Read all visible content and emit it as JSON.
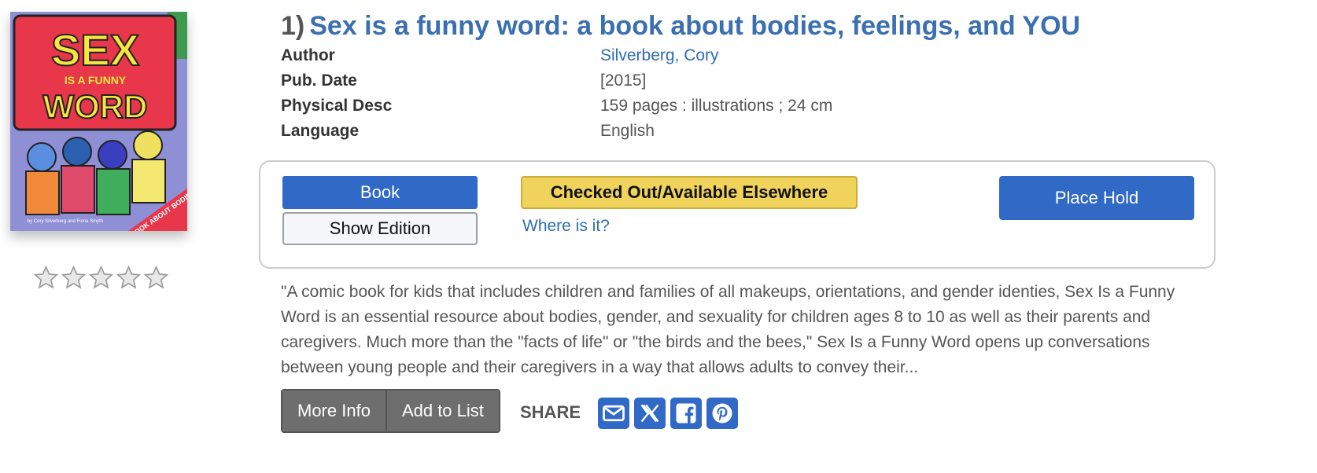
{
  "result": {
    "number": "1)",
    "title": "Sex is a funny word: a book about bodies, feelings, and YOU"
  },
  "cover": {
    "title_line1": "SEX",
    "title_line2": "IS A FUNNY",
    "title_line3": "WORD",
    "tagline": "A BOOK ABOUT BODIES, FEELINGS, AND YOU",
    "credit": "by Cory Silverberg and Fiona Smyth"
  },
  "rating": {
    "stars_filled": 0,
    "stars_total": 5
  },
  "details": [
    {
      "label": "Author",
      "value": "Silverberg, Cory",
      "is_link": true
    },
    {
      "label": "Pub. Date",
      "value": "[2015]",
      "is_link": false
    },
    {
      "label": "Physical Desc",
      "value": "159 pages : illustrations ; 24 cm",
      "is_link": false
    },
    {
      "label": "Language",
      "value": "English",
      "is_link": false
    }
  ],
  "availability": {
    "format_button": "Book",
    "show_edition_button": "Show Edition",
    "status": "Checked Out/Available Elsewhere",
    "where_link": "Where is it?",
    "place_hold_button": "Place Hold"
  },
  "summary": "\"A comic book for kids that includes children and families of all makeups, orientations, and gender identies, Sex Is a Funny Word is an essential resource about bodies, gender, and sexuality for children ages 8 to 10 as well as their parents and caregivers. Much more than the \"facts of life\" or \"the birds and the bees,\" Sex Is a Funny Word opens up conversations between young people and their caregivers in a way that allows adults to convey their...",
  "actions": {
    "more_info": "More Info",
    "add_to_list": "Add to List",
    "share_label": "SHARE",
    "share_icons": [
      "envelope-icon",
      "x-twitter-icon",
      "facebook-icon",
      "pinterest-icon"
    ]
  },
  "colors": {
    "title": "#3a6fb0",
    "link": "#2e6db4",
    "primary_button": "#3169c6",
    "status_badge": "#f0d35a",
    "secondary_button": "#6e6e6e"
  }
}
